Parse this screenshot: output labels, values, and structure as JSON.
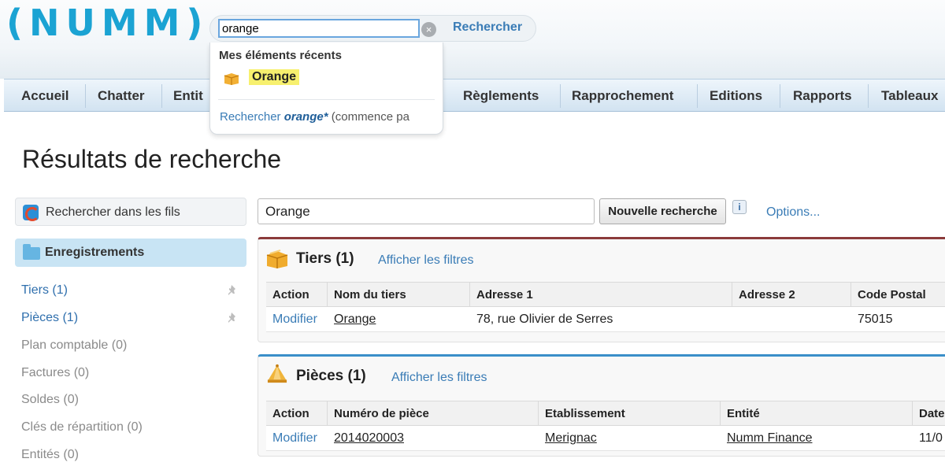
{
  "app": {
    "logo": "(NUMM)"
  },
  "search": {
    "value": "orange",
    "clear_glyph": "×",
    "button": "Rechercher"
  },
  "nav": {
    "items": [
      "Accueil",
      "Chatter",
      "Entit",
      "Règlements",
      "Rapprochement",
      "Editions",
      "Rapports",
      "Tableaux"
    ]
  },
  "dropdown": {
    "heading": "Mes éléments récents",
    "recent": [
      {
        "label": "Orange",
        "icon": "account-box-icon"
      }
    ],
    "search_link": {
      "prefix": "Rechercher ",
      "term": "orange*",
      "suffix": " (commence pa"
    }
  },
  "page": {
    "title": "Résultats de recherche"
  },
  "sidebar": {
    "search_feeds": "Rechercher dans les fils",
    "header": "Enregistrements",
    "items": [
      {
        "label": "Tiers (1)",
        "active": true
      },
      {
        "label": "Pièces (1)",
        "active": true
      },
      {
        "label": "Plan comptable (0)",
        "active": false
      },
      {
        "label": "Factures (0)",
        "active": false
      },
      {
        "label": "Soldes (0)",
        "active": false
      },
      {
        "label": "Clés de répartition (0)",
        "active": false
      },
      {
        "label": "Entités (0)",
        "active": false
      }
    ],
    "pin_glyph": "📌"
  },
  "main": {
    "search_value": "Orange",
    "new_search": "Nouvelle recherche",
    "info_glyph": "i",
    "options": "Options..."
  },
  "results": {
    "tiers": {
      "title": "Tiers (1)",
      "filters_link": "Afficher les filtres",
      "columns": [
        "Action",
        "Nom du tiers",
        "Adresse 1",
        "Adresse 2",
        "Code Postal"
      ],
      "rows": [
        {
          "action": "Modifier",
          "name": "Orange",
          "address1": "78, rue Olivier de Serres",
          "address2": "",
          "postal": "75015"
        }
      ]
    },
    "pieces": {
      "title": "Pièces (1)",
      "filters_link": "Afficher les filtres",
      "columns": [
        "Action",
        "Numéro de pièce",
        "Etablissement",
        "Entité",
        "Date"
      ],
      "rows": [
        {
          "action": "Modifier",
          "number": "2014020003",
          "establishment": "Merignac",
          "entity": "Numm Finance",
          "date": "11/0"
        }
      ]
    }
  }
}
